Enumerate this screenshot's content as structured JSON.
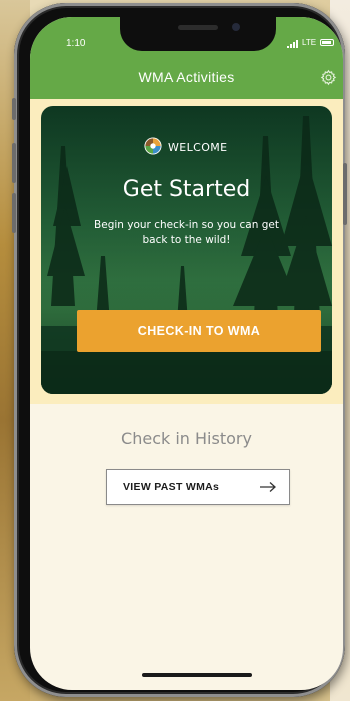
{
  "status_bar": {
    "time": "1:10",
    "network": "LTE"
  },
  "header": {
    "title": "WMA Activities",
    "settings_icon": "gear-icon",
    "color": "#65a947"
  },
  "welcome_card": {
    "badge_icon": "logo-badge-icon",
    "badge_label": "WELCOME",
    "headline": "Get Started",
    "subtext": "Begin your check-in so you can get back to the wild!",
    "cta_label": "CHECK-IN TO WMA",
    "cta_color": "#eba22f"
  },
  "history": {
    "title": "Check in History",
    "button_label": "VIEW PAST WMAs",
    "button_icon": "arrow-right-icon"
  }
}
